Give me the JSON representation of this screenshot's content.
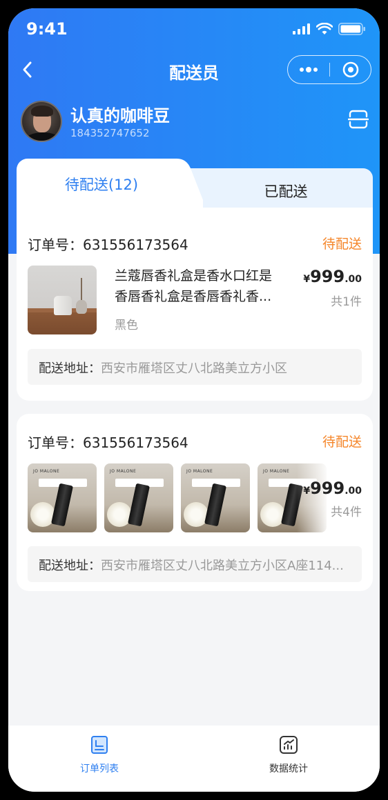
{
  "status_bar": {
    "time": "9:41"
  },
  "nav": {
    "title": "配送员"
  },
  "profile": {
    "name": "认真的咖啡豆",
    "phone": "184352747652"
  },
  "tabs": [
    {
      "label": "待配送(12)",
      "active": true
    },
    {
      "label": "已配送",
      "active": false
    }
  ],
  "orders": [
    {
      "order_label": "订单号：",
      "order_no": "631556173564",
      "status": "待配送",
      "product_title": "兰蔻唇香礼盒是香水口红是香唇香礼盒是香唇香礼香...",
      "spec": "黑色",
      "price_symbol": "¥",
      "price_int": "999",
      "price_dec": ".00",
      "qty": "共1件",
      "address_label": "配送地址：",
      "address": "西安市雁塔区丈八北路美立方小区"
    },
    {
      "order_label": "订单号：",
      "order_no": "631556173564",
      "status": "待配送",
      "thumb_brand": "JO MALONE",
      "price_symbol": "¥",
      "price_int": "999",
      "price_dec": ".00",
      "qty": "共4件",
      "address_label": "配送地址：",
      "address": "西安市雁塔区丈八北路美立方小区A座114..."
    }
  ],
  "tabbar": [
    {
      "label": "订单列表",
      "icon": "order-list-icon",
      "active": true
    },
    {
      "label": "数据统计",
      "icon": "statistics-icon",
      "active": false
    }
  ],
  "colors": {
    "accent": "#2e7ff0",
    "status_orange": "#f5862a",
    "header_start": "#2f79f4",
    "header_end": "#1f95f8"
  }
}
